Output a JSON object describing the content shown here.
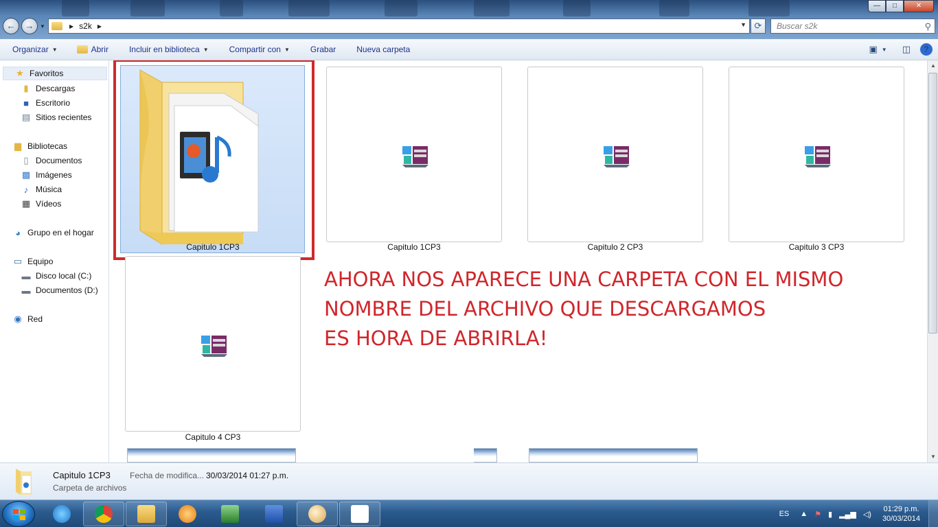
{
  "window": {
    "address_segments": [
      "s2k"
    ],
    "search_placeholder": "Buscar s2k",
    "controls": {
      "minimize": "—",
      "maximize": "□",
      "close": "✕"
    }
  },
  "commandbar": {
    "organize": "Organizar",
    "open": "Abrir",
    "include_library": "Incluir en biblioteca",
    "share": "Compartir con",
    "burn": "Grabar",
    "new_folder": "Nueva carpeta"
  },
  "nav": {
    "favorites": "Favoritos",
    "downloads": "Descargas",
    "desktop": "Escritorio",
    "recent": "Sitios recientes",
    "libraries": "Bibliotecas",
    "documents": "Documentos",
    "images": "Imágenes",
    "music": "Música",
    "videos": "Vídeos",
    "homegroup": "Grupo en el hogar",
    "computer": "Equipo",
    "local_disk": "Disco local (C:)",
    "docs_drive": "Documentos (D:)",
    "network": "Red"
  },
  "items": [
    {
      "name": "Capitulo 1CP3",
      "kind": "folder"
    },
    {
      "name": "Capitulo 1CP3",
      "kind": "rar"
    },
    {
      "name": "Capitulo 2 CP3",
      "kind": "rar"
    },
    {
      "name": "Capitulo 3  CP3",
      "kind": "rar"
    },
    {
      "name": "Capitulo 4   CP3",
      "kind": "rar"
    }
  ],
  "annotation": {
    "line1": "AHORA NOS APARECE UNA CARPETA CON EL MISMO",
    "line2": "NOMBRE DEL ARCHIVO QUE DESCARGAMOS",
    "line3": "ES HORA DE ABRIRLA!"
  },
  "details": {
    "name": "Capitulo 1CP3",
    "type": "Carpeta de archivos",
    "modified_label": "Fecha de modifica...",
    "modified_value": "30/03/2014 01:27 p.m."
  },
  "taskbar": {
    "language": "ES",
    "time": "01:29 p.m.",
    "date": "30/03/2014",
    "apps": [
      "internet-explorer",
      "chrome",
      "file-explorer",
      "media-player",
      "task-manager",
      "word",
      "paint",
      "winrar"
    ]
  },
  "colors": {
    "highlight_border": "#d02a2a",
    "annotation_text": "#d0262b",
    "selection_fill": "#cfe1f8"
  }
}
